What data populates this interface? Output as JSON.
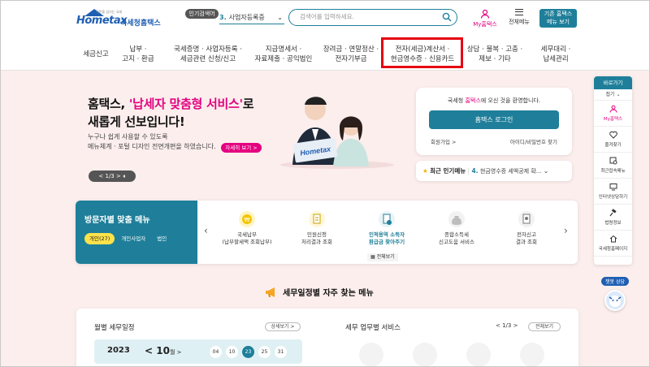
{
  "header": {
    "logo_word": "Hometax",
    "logo_tagline": "국민을 섬기는 국세",
    "logo_text": "국세청홈택스",
    "popular_badge": "인기검색어",
    "popular_item": {
      "num": "3.",
      "text": "사업자등록증"
    },
    "search_placeholder": "검색어를 입력하세요.",
    "my_hometax": "My홈택스",
    "all_menu": "전체메뉴",
    "old_hometax_line1": "기존 홈택스",
    "old_hometax_line2": "메뉴 보기"
  },
  "gnb": [
    "세금신고",
    "납부 ·\n고지 · 환급",
    "국세증명 · 사업자등록 ·\n세금관련 신청/신고",
    "지급명세서 ·\n자료제출 · 공익법인",
    "장려금 · 연말정산 ·\n전자기부금",
    "전자(세금)계산서 ·\n현금영수증 · 신용카드",
    "상담 · 불복 · 고충 ·\n제보 · 기타",
    "세무대리 ·\n납세관리"
  ],
  "hero": {
    "title_prefix": "홈택스, ",
    "title_highlight": "'납세자 맞춤형 서비스'",
    "title_suffix": "로",
    "title_line2": "새롭게 선보입니다!",
    "sub_line1": "누구나 쉽게 사용할 수 있도록",
    "sub_line2": "메뉴체계 · 포털 디자인 전면개편을 하였습니다.",
    "more_button": "자세히 보기 >",
    "pager": "< 1/3 >  ⏸"
  },
  "login": {
    "welcome_prefix": "국세청 ",
    "welcome_brand": "홈택스",
    "welcome_suffix": "에 오신 것을 환영합니다.",
    "login_button": "홈택스 로그인",
    "signup": "회원가입 >",
    "find_id": "아이디/비밀번호 찾기"
  },
  "popular_menu": {
    "label": "최근 인기메뉴",
    "num": "4.",
    "text": "현금영수증 세액공제 확..."
  },
  "visitor": {
    "title": "방문자별 맞춤 메뉴",
    "tabs": [
      "개인(27)",
      "개인사업자",
      "법인"
    ],
    "services": [
      {
        "line1": "국세납부",
        "line2": "(납부할세액 조회납부)"
      },
      {
        "line1": "민원신청",
        "line2": "처리결과 조회"
      },
      {
        "line1": "인적용역 소득자",
        "line2": "환급금 찾아주기"
      },
      {
        "line1": "종합소득세",
        "line2": "신고도움 서비스"
      },
      {
        "line1": "전자신고",
        "line2": "결과 조회"
      }
    ],
    "view_all": "전체보기"
  },
  "section_title": "세무일정별 자주 찾는 메뉴",
  "schedule": {
    "title": "월별 세무일정",
    "detail": "상세보기 >",
    "year": "2023",
    "month": "< 10",
    "month_unit": "월 >",
    "days": [
      "04",
      "10",
      "23",
      "25",
      "31"
    ],
    "selected_day": "23"
  },
  "work": {
    "title": "세무 업무별 서비스",
    "pager": "< 1/3 >",
    "view_all": "전체보기"
  },
  "quick": {
    "head": "바로가기",
    "fold": "접기 ⌄",
    "items": [
      "My홈택스",
      "즐겨찾기",
      "최근접속메뉴",
      "인터넷상담하기",
      "법령정보",
      "국세청홈페이지"
    ]
  },
  "chatbot": "챗봇 상담",
  "colors": {
    "accent": "#1f7f9a",
    "brand_pink": "#e4007f",
    "hero_bg": "#fbeeed",
    "highlight_box": "#e60012"
  }
}
